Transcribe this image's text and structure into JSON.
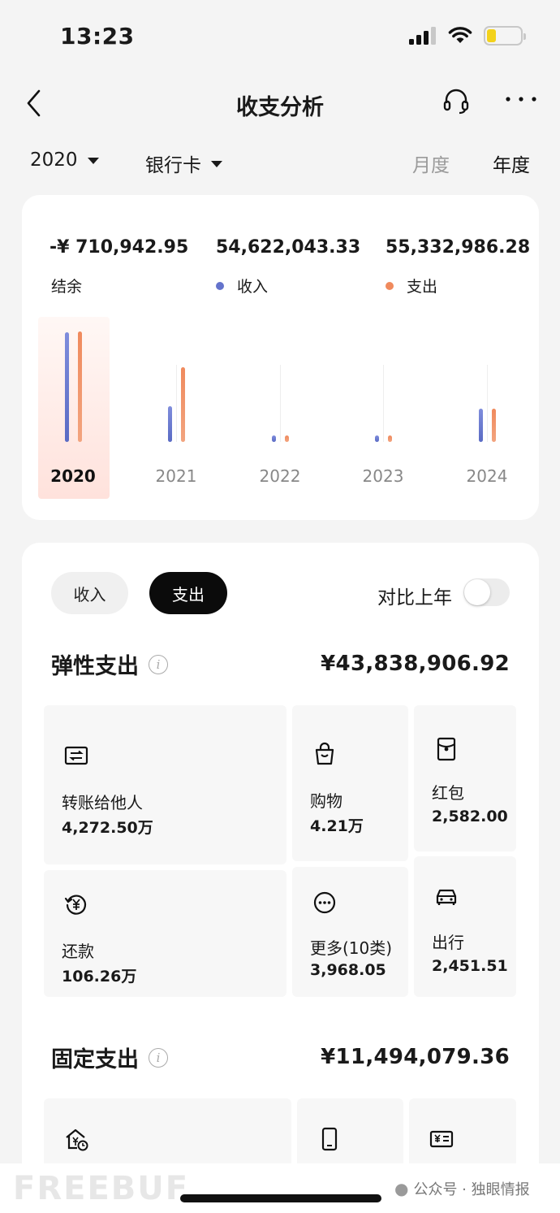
{
  "status_bar": {
    "time": "13:23"
  },
  "header": {
    "title": "收支分析"
  },
  "filters": {
    "year": "2020",
    "account": "银行卡",
    "period_monthly": "月度",
    "period_yearly": "年度",
    "selected_period": "年度"
  },
  "summary": {
    "balance_amount": "-¥ 710,942.95",
    "balance_label": "结余",
    "income_amount": "54,622,043.33",
    "income_label": "收入",
    "expense_amount": "55,332,986.28",
    "expense_label": "支出",
    "colors": {
      "income": "#6473cc",
      "expense": "#f08a5d",
      "highlight": "#ffe4dd"
    }
  },
  "chart_data": {
    "type": "bar",
    "categories": [
      "2020",
      "2021",
      "2022",
      "2023",
      "2024"
    ],
    "selected": "2020",
    "series": [
      {
        "name": "收入",
        "values": [
          54622043.33,
          18000000,
          400000,
          400000,
          16500000
        ]
      },
      {
        "name": "支出",
        "values": [
          55332986.28,
          37500000,
          300000,
          300000,
          16500000
        ]
      }
    ],
    "ylim": [
      0,
      56000000
    ]
  },
  "detail": {
    "tab_income": "收入",
    "tab_expense": "支出",
    "active_tab": "支出",
    "compare_label": "对比上年",
    "compare_enabled": false,
    "flexible": {
      "title": "弹性支出",
      "total": "¥43,838,906.92",
      "items": [
        {
          "icon": "transfer-icon",
          "name": "转账给他人",
          "value": "4,272.50万"
        },
        {
          "icon": "shopping-bag-icon",
          "name": "购物",
          "value": "4.21万"
        },
        {
          "icon": "red-packet-icon",
          "name": "红包",
          "value": "2,582.00"
        },
        {
          "icon": "repayment-icon",
          "name": "还款",
          "value": "106.26万"
        },
        {
          "icon": "more-dots-icon",
          "name": "更多(10类)",
          "value": "3,968.05"
        },
        {
          "icon": "car-icon",
          "name": "出行",
          "value": "2,451.51"
        }
      ]
    },
    "fixed": {
      "title": "固定支出",
      "total": "¥11,494,079.36",
      "items": [
        {
          "icon": "house-yuan-icon"
        },
        {
          "icon": "phone-icon"
        },
        {
          "icon": "invoice-icon"
        }
      ]
    }
  },
  "watermark": {
    "left": "FREEBUF",
    "right": "公众号 · 独眼情报"
  }
}
